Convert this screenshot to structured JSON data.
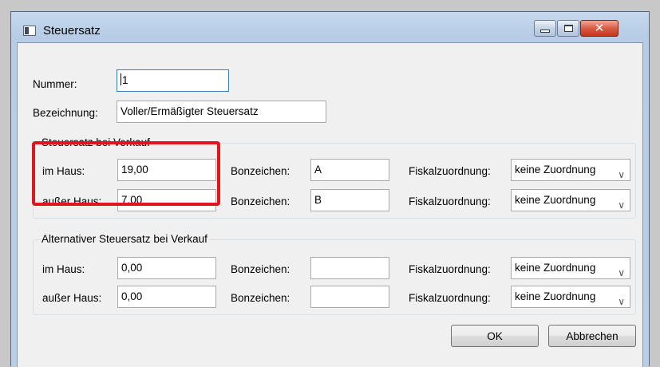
{
  "window": {
    "title": "Steuersatz",
    "icon": "window-app-icon",
    "controls": {
      "minimize": "minimize-icon",
      "maximize": "maximize-icon",
      "close": "close-icon",
      "close_glyph": "✕"
    }
  },
  "form": {
    "nummer_label": "Nummer:",
    "nummer_value": "1",
    "bezeichnung_label": "Bezeichnung:",
    "bezeichnung_value": "Voller/Ermäßigter Steuersatz"
  },
  "group_main": {
    "legend": "Steuersatz bei Verkauf",
    "rows": [
      {
        "label": "im Haus:",
        "rate": "19,00",
        "bon_label": "Bonzeichen:",
        "bon_value": "A",
        "fiskal_label": "Fiskalzuordnung:",
        "fiskal_value": "keine Zuordnung"
      },
      {
        "label": "außer Haus:",
        "rate": "7,00",
        "bon_label": "Bonzeichen:",
        "bon_value": "B",
        "fiskal_label": "Fiskalzuordnung:",
        "fiskal_value": "keine Zuordnung"
      }
    ]
  },
  "group_alt": {
    "legend": "Alternativer Steuersatz bei Verkauf",
    "rows": [
      {
        "label": "im Haus:",
        "rate": "0,00",
        "bon_label": "Bonzeichen:",
        "bon_value": "",
        "fiskal_label": "Fiskalzuordnung:",
        "fiskal_value": "keine Zuordnung"
      },
      {
        "label": "außer Haus:",
        "rate": "0,00",
        "bon_label": "Bonzeichen:",
        "bon_value": "",
        "fiskal_label": "Fiskalzuordnung:",
        "fiskal_value": "keine Zuordnung"
      }
    ]
  },
  "dropdown_arrow": "∨",
  "buttons": {
    "ok": "OK",
    "cancel": "Abbrechen"
  },
  "colors": {
    "highlight": "#e0161c",
    "titlebar": "#b9cfe7",
    "close_button": "#c2371c"
  }
}
